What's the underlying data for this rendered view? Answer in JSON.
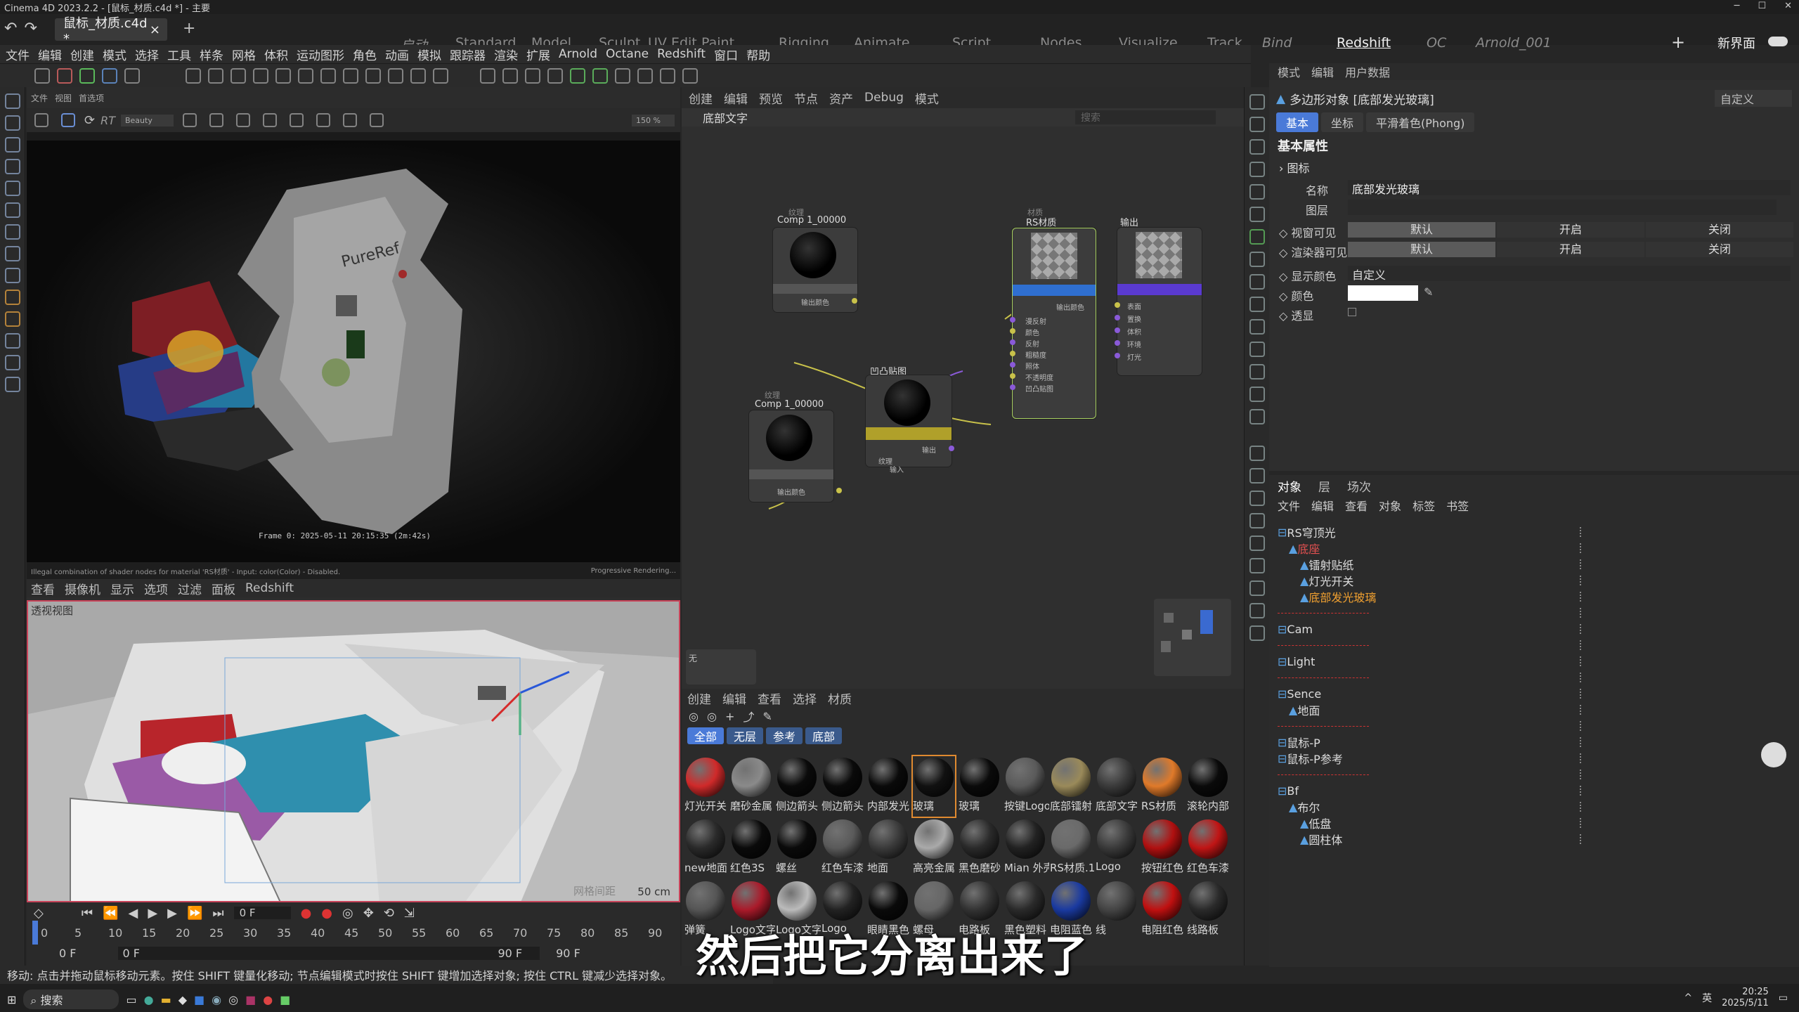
{
  "window": {
    "title": "Cinema 4D 2023.2.2 - [鼠标_材质.c4d *] - 主要"
  },
  "tabs": {
    "doc": "鼠标_材质.c4d *",
    "close": "×",
    "add": "+"
  },
  "layouts": [
    "启动",
    "Standard",
    "Model",
    "Sculpt",
    "UV Edit",
    "Paint",
    "Rigging",
    "Animate",
    "Script",
    "Nodes",
    "Visualize",
    "Track",
    "Bind",
    "Redshift",
    "OC",
    "Arnold_001"
  ],
  "layout_active": "Redshift",
  "new_layout": "新界面",
  "menu": [
    "文件",
    "编辑",
    "创建",
    "模式",
    "选择",
    "工具",
    "样条",
    "网格",
    "体积",
    "运动图形",
    "角色",
    "动画",
    "模拟",
    "跟踪器",
    "渲染",
    "扩展",
    "Arnold",
    "Octane",
    "Redshift",
    "窗口",
    "帮助"
  ],
  "left_mini_menu": [
    "文件",
    "视图",
    "首选项"
  ],
  "renderview": {
    "rt": "RT",
    "beauty": "Beauty",
    "zoom": "150 %",
    "frame_info": "Frame  0:  2025-05-11  20:15:35  (2m:42s)",
    "status_left": "Illegal combination of shader nodes for material 'RS材质' - Input: color(Color) - Disabled.",
    "status_right": "Progressive Rendering..."
  },
  "viewport": {
    "menu": [
      "查看",
      "摄像机",
      "显示",
      "选项",
      "过滤",
      "面板",
      "Redshift"
    ],
    "label": "透视视图",
    "scale": "50 cm",
    "grid": "网格间距"
  },
  "timeline": {
    "frame": "0 F",
    "start": "0 F",
    "start2": "0 F",
    "end": "90 F",
    "end2": "90 F",
    "ticks": [
      "0",
      "5",
      "10",
      "15",
      "20",
      "25",
      "30",
      "35",
      "40",
      "45",
      "50",
      "55",
      "60",
      "65",
      "70",
      "75",
      "80",
      "85",
      "90"
    ]
  },
  "node_editor": {
    "menu": [
      "创建",
      "编辑",
      "预览",
      "节点",
      "资产",
      "Debug",
      "模式"
    ],
    "path": "底部文字",
    "search": "搜索",
    "empty_label": "无",
    "nodes": {
      "tex1": {
        "cat": "纹理",
        "title": "Comp 1_00000",
        "port": "输出颜色"
      },
      "tex2": {
        "cat": "纹理",
        "title": "Comp 1_00000",
        "port": "输出颜色"
      },
      "bump": {
        "title": "凹凸贴图",
        "out": "输出",
        "in1": "纹理",
        "in2": "输入"
      },
      "rsmat": {
        "cat": "材质",
        "title": "RS材质",
        "out": "输出颜色",
        "ports": [
          "漫反射",
          "颜色",
          "反射",
          "粗糙度",
          "照体",
          "不透明度",
          "凹凸贴图"
        ]
      },
      "output": {
        "title": "输出",
        "ports": [
          "表面",
          "置换",
          "体积",
          "环境",
          "灯光"
        ]
      }
    }
  },
  "material_manager": {
    "menu": [
      "创建",
      "编辑",
      "查看",
      "选择",
      "材质"
    ],
    "filters": [
      "全部",
      "无层",
      "参考",
      "底部"
    ],
    "materials": [
      {
        "name": "灯光开关",
        "color": "#d02a2a"
      },
      {
        "name": "磨砂金属",
        "color": "#8a8a8a"
      },
      {
        "name": "侧边箭头",
        "color": "#0a0a0a"
      },
      {
        "name": "侧边箭头",
        "color": "#0a0a0a"
      },
      {
        "name": "内部发光",
        "color": "#0a0a0a"
      },
      {
        "name": "玻璃",
        "color": "#111111"
      },
      {
        "name": "玻璃",
        "color": "#0a0a0a"
      },
      {
        "name": "按键Logo",
        "color": "#5a5a5a"
      },
      {
        "name": "底部镭射",
        "color": "#9a8a5a"
      },
      {
        "name": "底部文字",
        "color": "#3a3a3a"
      },
      {
        "name": "RS材质",
        "color": "#e07a2a"
      },
      {
        "name": "滚轮内部",
        "color": "#0a0a0a"
      },
      {
        "name": "new地面",
        "color": "#2a2a2a"
      },
      {
        "name": "红色3S",
        "color": "#0a0a0a"
      },
      {
        "name": "螺丝",
        "color": "#0a0a0a"
      },
      {
        "name": "红色车漆",
        "color": "#5a5a5a"
      },
      {
        "name": "地面",
        "color": "#3a3a3a"
      },
      {
        "name": "高亮金属",
        "color": "#aaaaaa"
      },
      {
        "name": "黑色磨砂",
        "color": "#2a2a2a"
      },
      {
        "name": "Mian 外壳",
        "color": "#222222"
      },
      {
        "name": "RS材质.1",
        "color": "#6a6a6a"
      },
      {
        "name": "Logo",
        "color": "#3a3a3a"
      },
      {
        "name": "按钮红色",
        "color": "#b01010"
      },
      {
        "name": "红色车漆",
        "color": "#c01515"
      },
      {
        "name": "弹簧",
        "color": "#555555"
      },
      {
        "name": "Logo文字",
        "color": "#aa1a2a"
      },
      {
        "name": "Logo文字",
        "color": "#bbbbbb"
      },
      {
        "name": "Logo",
        "color": "#222222"
      },
      {
        "name": "眼睛黑色",
        "color": "#0a0a0a"
      },
      {
        "name": "螺母",
        "color": "#666666"
      },
      {
        "name": "电路板",
        "color": "#333333"
      },
      {
        "name": "黑色塑料",
        "color": "#2a2a2a"
      },
      {
        "name": "电阻蓝色",
        "color": "#1a3aa0"
      },
      {
        "name": "线",
        "color": "#444444"
      },
      {
        "name": "电阻红色",
        "color": "#c01010"
      },
      {
        "name": "线路板",
        "color": "#2a2a2a"
      }
    ]
  },
  "attributes": {
    "menu": [
      "模式",
      "编辑",
      "用户数据"
    ],
    "object_title": "多边形对象 [底部发光玻璃]",
    "preset": "自定义",
    "tabs": [
      "基本",
      "坐标",
      "平滑着色(Phong)"
    ],
    "section": "基本属性",
    "group": "图标",
    "name_label": "名称",
    "name_value": "底部发光玻璃",
    "layer_label": "图层",
    "vis_editor": "视窗可见",
    "vis_render": "渲染器可见",
    "default": "默认",
    "on": "开启",
    "off": "关闭",
    "display_color": "显示颜色",
    "display_color_value": "自定义",
    "color_label": "颜色",
    "xray": "透显"
  },
  "objects": {
    "tabs": [
      "对象",
      "层",
      "场次"
    ],
    "menu": [
      "文件",
      "编辑",
      "查看",
      "对象",
      "标签",
      "书签"
    ],
    "rows": [
      {
        "name": "RS穹顶光",
        "indent": 0,
        "color": "#ddd"
      },
      {
        "name": "底座",
        "indent": 1,
        "color": "#e05050"
      },
      {
        "name": "镭射贴纸",
        "indent": 2,
        "color": "#ddd"
      },
      {
        "name": "灯光开关",
        "indent": 2,
        "color": "#ddd"
      },
      {
        "name": "底部发光玻璃",
        "indent": 2,
        "color": "#f0a030"
      },
      {
        "name": "",
        "indent": 0,
        "color": "#ddd"
      },
      {
        "name": "Cam",
        "indent": 0,
        "color": "#ddd"
      },
      {
        "name": "",
        "indent": 0,
        "color": "#ddd"
      },
      {
        "name": "Light",
        "indent": 0,
        "color": "#ddd"
      },
      {
        "name": "",
        "indent": 0,
        "color": "#ddd"
      },
      {
        "name": "Sence",
        "indent": 0,
        "color": "#ddd"
      },
      {
        "name": "地面",
        "indent": 1,
        "color": "#ddd"
      },
      {
        "name": "",
        "indent": 0,
        "color": "#ddd"
      },
      {
        "name": "鼠标-P",
        "indent": 0,
        "color": "#ddd"
      },
      {
        "name": "鼠标-P参考",
        "indent": 0,
        "color": "#ddd"
      },
      {
        "name": "",
        "indent": 0,
        "color": "#ddd"
      },
      {
        "name": "Bf",
        "indent": 0,
        "color": "#ddd"
      },
      {
        "name": "布尔",
        "indent": 1,
        "color": "#ddd"
      },
      {
        "name": "低盘",
        "indent": 2,
        "color": "#ddd"
      },
      {
        "name": "圆柱体",
        "indent": 2,
        "color": "#ddd"
      }
    ]
  },
  "statusbar": "移动: 点击并拖动鼠标移动元素。按住 SHIFT 键量化移动; 节点编辑模式时按住 SHIFT 键增加选择对象; 按住 CTRL 键减少选择对象。",
  "subtitle": "然后把它分离出来了",
  "taskbar": {
    "search": "搜索",
    "time": "20:25",
    "date": "2025/5/11",
    "lang": "英"
  }
}
